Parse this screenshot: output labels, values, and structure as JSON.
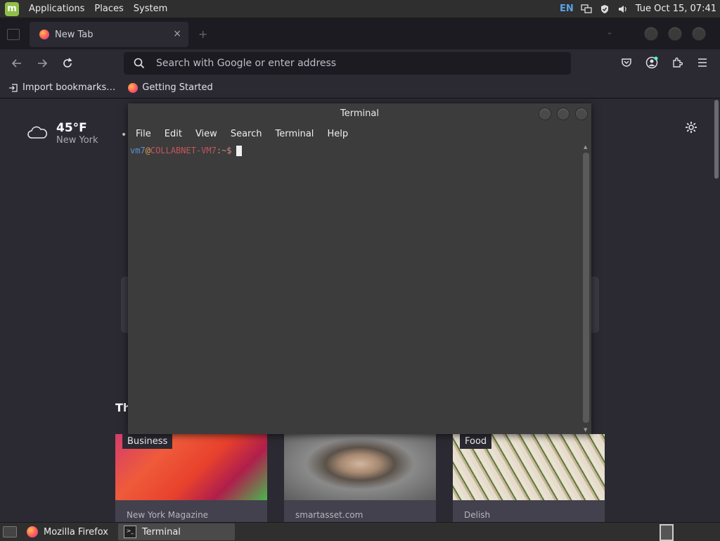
{
  "top_panel": {
    "menus": [
      "Applications",
      "Places",
      "System"
    ],
    "language": "EN",
    "clock": "Tue Oct 15, 07:41"
  },
  "firefox": {
    "tab_title": "New Tab",
    "tab_close": "×",
    "new_tab_plus": "+",
    "search_placeholder": "Search with Google or enter address",
    "bookmarks": [
      {
        "label": "Import bookmarks…"
      },
      {
        "label": "Getting Started"
      }
    ],
    "weather": {
      "temp": "45°F",
      "city": "New York"
    },
    "section_heading": "Th",
    "cards": [
      {
        "tag": "Business",
        "source": "New York Magazine"
      },
      {
        "tag": "",
        "source": "smartasset.com"
      },
      {
        "tag": "Food",
        "source": "Delish"
      }
    ]
  },
  "terminal": {
    "title": "Terminal",
    "menu": [
      "File",
      "Edit",
      "View",
      "Search",
      "Terminal",
      "Help"
    ],
    "prompt": {
      "user": "vm7",
      "at": "@",
      "host": "COLLABNET-VM7",
      "path": ":~$"
    }
  },
  "taskbar": {
    "tasks": [
      {
        "label": "Mozilla Firefox"
      },
      {
        "label": "Terminal"
      }
    ]
  }
}
